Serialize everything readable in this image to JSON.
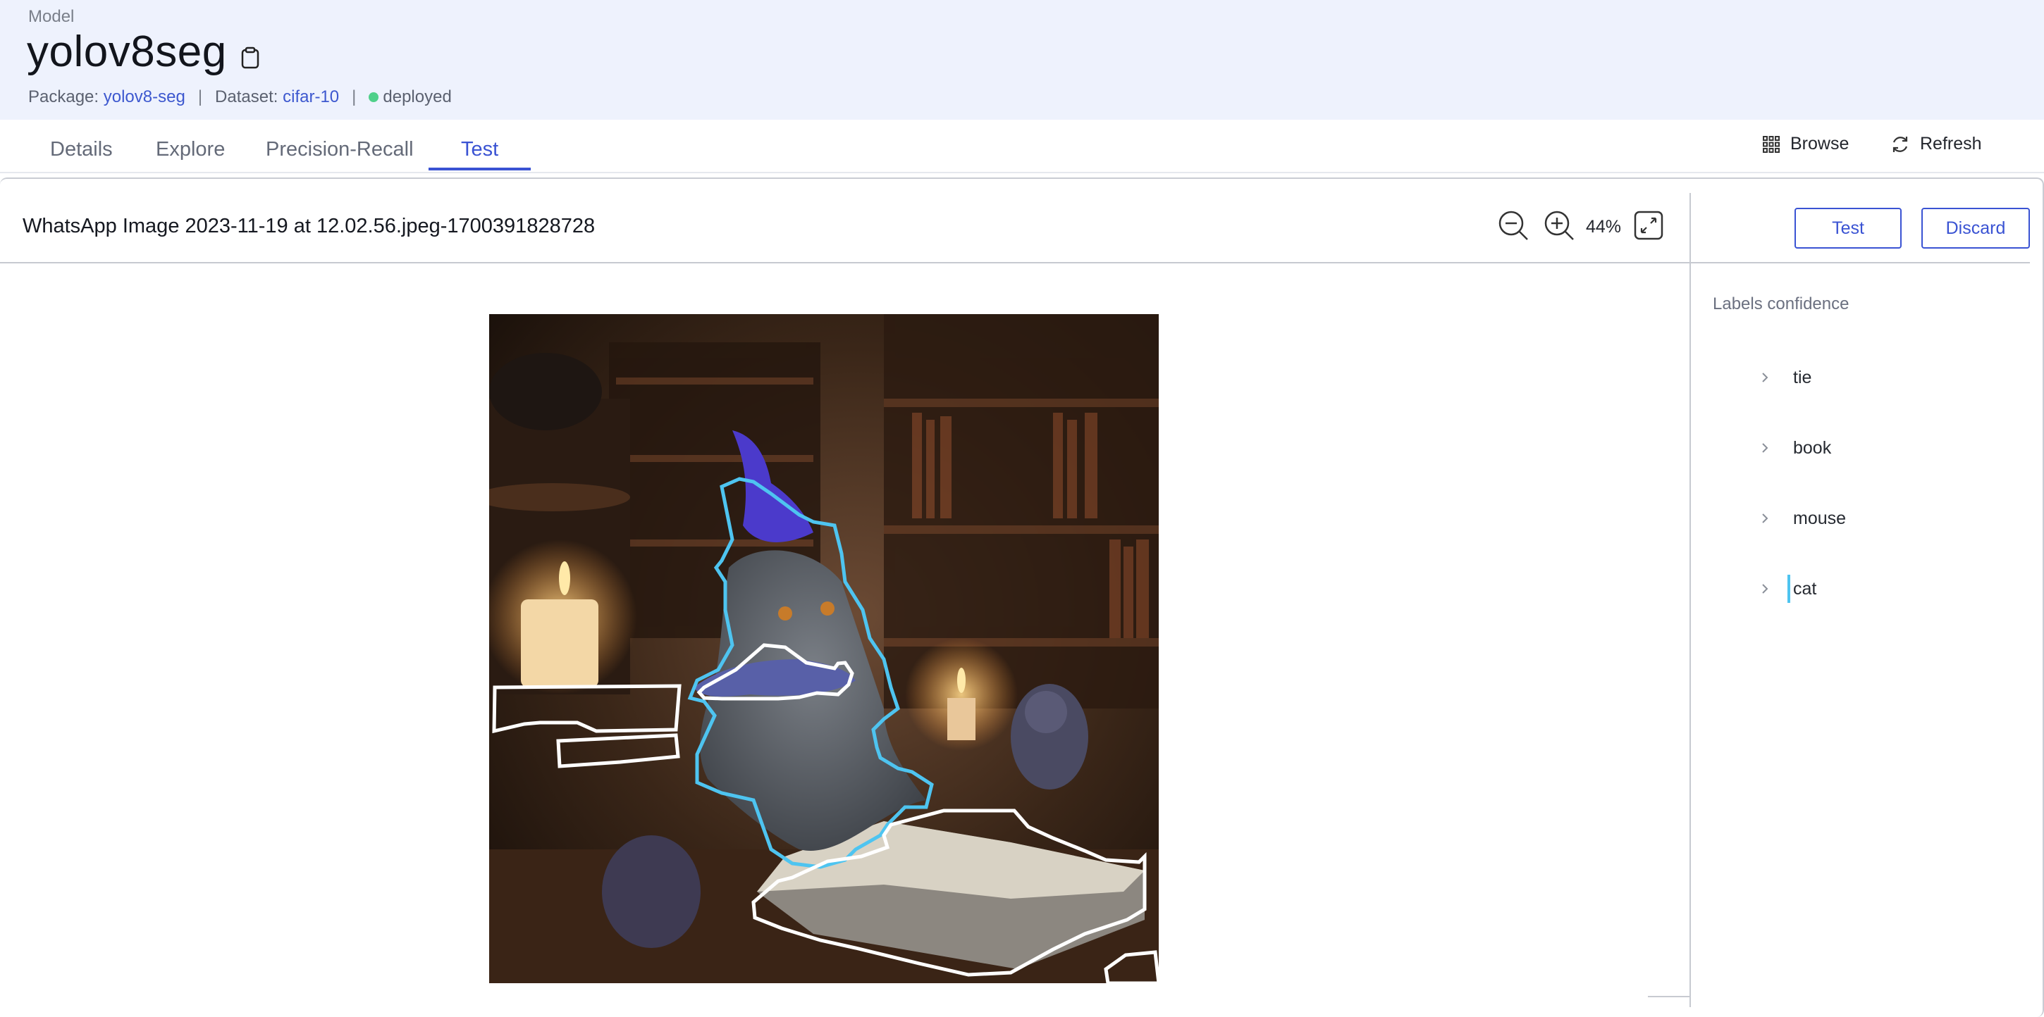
{
  "header": {
    "kind_label": "Model",
    "title": "yolov8seg",
    "package_label": "Package:",
    "package_value": "yolov8-seg",
    "dataset_label": "Dataset:",
    "dataset_value": "cifar-10",
    "separator": "|",
    "status": "deployed",
    "status_color": "#4fd08a"
  },
  "tabs": [
    {
      "label": "Details"
    },
    {
      "label": "Explore"
    },
    {
      "label": "Precision-Recall"
    },
    {
      "label": "Test",
      "active": true
    }
  ],
  "actions": {
    "browse": "Browse",
    "refresh": "Refresh"
  },
  "viewer": {
    "file_name": "WhatsApp Image 2023-11-19 at 12.02.56.jpeg-1700391828728",
    "zoom": "44%",
    "test_button": "Test",
    "discard_button": "Discard"
  },
  "labels_panel": {
    "title": "Labels confidence",
    "items": [
      {
        "label": "tie"
      },
      {
        "label": "book"
      },
      {
        "label": "mouse"
      },
      {
        "label": "cat",
        "highlighted": true
      }
    ]
  },
  "colors": {
    "accent": "#3a53d3",
    "header_bg": "#eef2fd",
    "cat_mask": "#4ec4f0",
    "other_mask": "#ffffff"
  }
}
